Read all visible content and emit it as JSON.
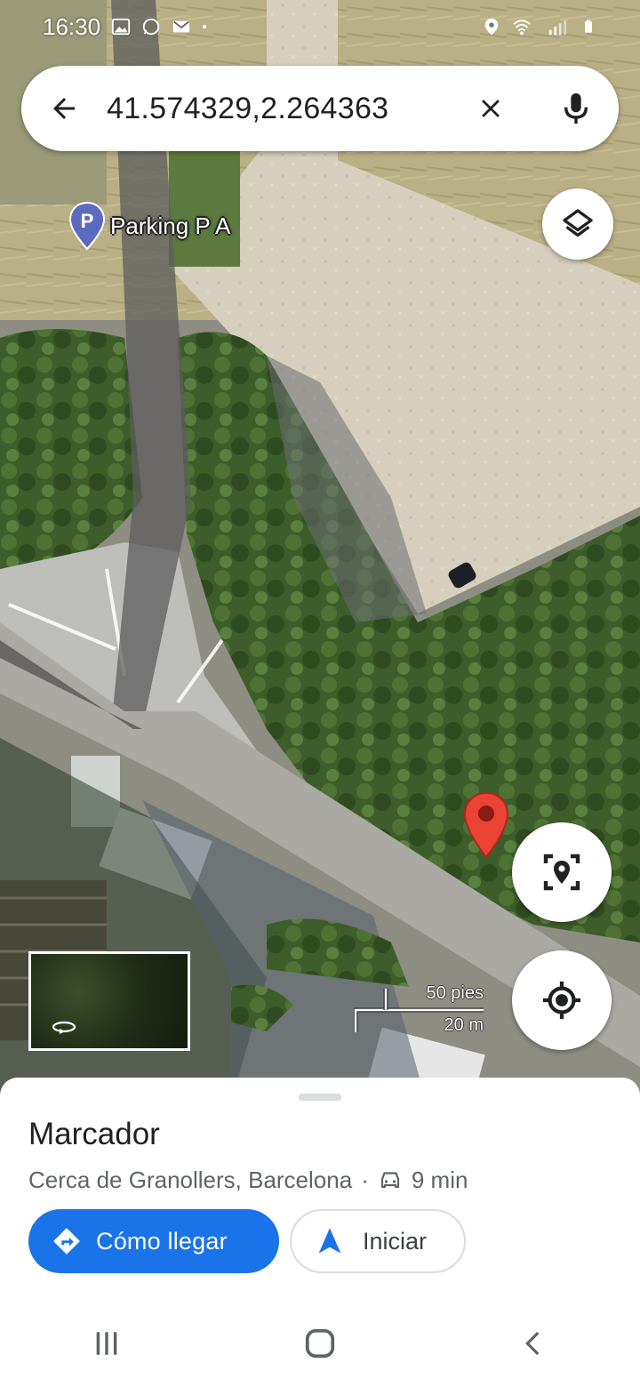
{
  "status_bar": {
    "time": "16:30",
    "left_icons": [
      "gallery-icon",
      "whatsapp-icon",
      "email-icon",
      "dot-icon"
    ],
    "right_icons": [
      "location-icon",
      "wifi-icon",
      "signal-icon",
      "battery-icon"
    ]
  },
  "search": {
    "query": "41.574329,2.264363",
    "back_icon": "back-arrow-icon",
    "clear_icon": "close-icon",
    "voice_icon": "microphone-icon"
  },
  "map": {
    "poi_label": "Parking P A",
    "poi_icon": "parking-pin-icon",
    "poi_letter": "P",
    "dropped_pin_icon": "red-pin-icon",
    "scale": {
      "imperial": "50 pies",
      "metric": "20 m"
    },
    "layers_icon": "layers-icon",
    "pin_location_icon": "pin-location-icon",
    "my_location_icon": "my-location-icon",
    "street_view_icon": "rotate-360-icon"
  },
  "place": {
    "title": "Marcador",
    "subtitle": "Cerca de Granollers, Barcelona",
    "separator": "·",
    "travel_mode_icon": "car-icon",
    "travel_time": "9 min"
  },
  "actions": {
    "directions_label": "Cómo llegar",
    "directions_icon": "directions-icon",
    "start_label": "Iniciar",
    "start_icon": "navigation-arrow-icon"
  },
  "nav": {
    "recents_icon": "recents-icon",
    "home_icon": "home-icon",
    "back_icon": "back-chevron-icon"
  },
  "colors": {
    "accent": "#1a73e8",
    "pin": "#ea4335",
    "parking_pin": "#5c6bc0"
  }
}
